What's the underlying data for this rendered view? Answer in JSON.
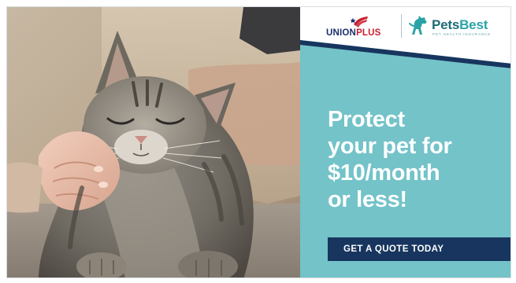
{
  "ad": {
    "union_logo": {
      "word_1": "UNION",
      "word_2": "PLUS"
    },
    "petsbest_logo": {
      "name_1": "Pets",
      "name_2": "Best",
      "tagline": "PET HEALTH INSURANCE"
    },
    "headline": {
      "line_1": "Protect",
      "line_2": "your pet for",
      "line_3": "$10/month",
      "line_4": "or less!"
    },
    "cta_label": "GET A QUOTE TODAY",
    "photo_icon": "cat-being-petted-photo",
    "colors": {
      "panel": "#73c3c9",
      "button": "#17355e",
      "union_blue": "#1b2f6e",
      "union_red": "#c8202f",
      "petsbest_teal": "#1e6b74"
    }
  }
}
